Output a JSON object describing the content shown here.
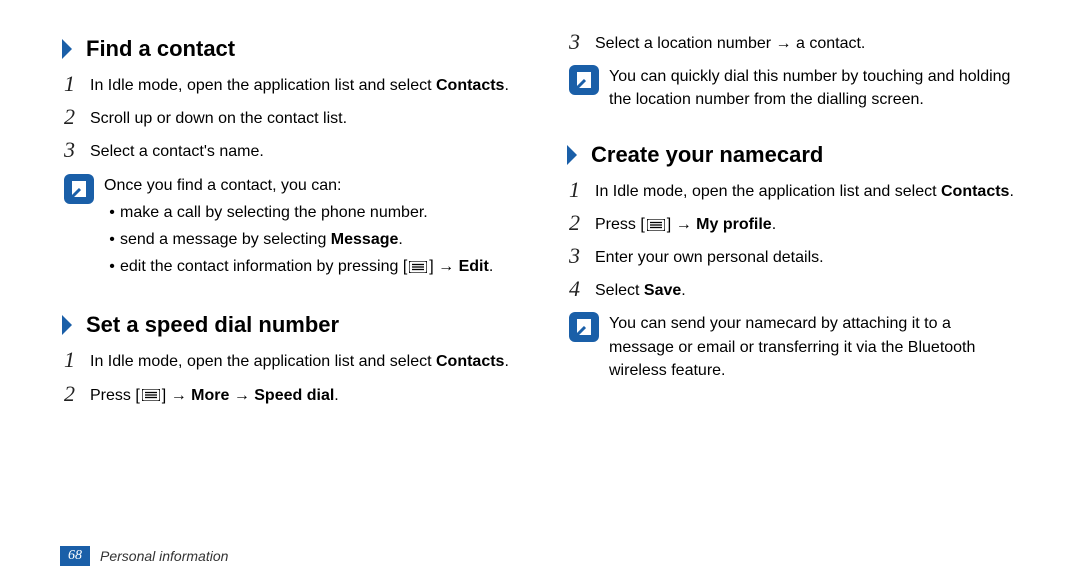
{
  "leftCol": {
    "section1": {
      "heading": "Find a contact",
      "step1": {
        "prefix": "In Idle mode, open the application list and select ",
        "bold": "Contacts",
        "suffix": "."
      },
      "step2": "Scroll up or down on the contact list.",
      "step3": "Select a contact's name.",
      "note": {
        "intro": "Once you find a contact, you can:",
        "b1": "make a call by selecting the phone number.",
        "b2_prefix": "send a message by selecting ",
        "b2_bold": "Message",
        "b2_suffix": ".",
        "b3_prefix": "edit the contact information by pressing [",
        "b3_mid": "] → ",
        "b3_bold": "Edit",
        "b3_suffix": "."
      }
    },
    "section2": {
      "heading": "Set a speed dial number",
      "step1": {
        "prefix": "In Idle mode, open the application list and select ",
        "bold": "Contacts",
        "suffix": "."
      },
      "step2": {
        "prefix": "Press [",
        "mid": "] → ",
        "bold": "More → Speed dial",
        "suffix": "."
      }
    }
  },
  "rightCol": {
    "cont": {
      "step3": "Select a location number → a contact.",
      "note": "You can quickly dial this number by touching and holding the location number from the dialling screen."
    },
    "section3": {
      "heading": "Create your namecard",
      "step1": {
        "prefix": "In Idle mode, open the application list and select ",
        "bold": "Contacts",
        "suffix": "."
      },
      "step2": {
        "prefix": "Press [",
        "mid": "] → ",
        "bold": "My profile",
        "suffix": "."
      },
      "step3": "Enter your own personal details.",
      "step4": {
        "prefix": "Select ",
        "bold": "Save",
        "suffix": "."
      },
      "note": "You can send your namecard by attaching it to a message or email or transferring it via the Bluetooth wireless feature."
    }
  },
  "footer": {
    "page": "68",
    "section": "Personal information"
  }
}
